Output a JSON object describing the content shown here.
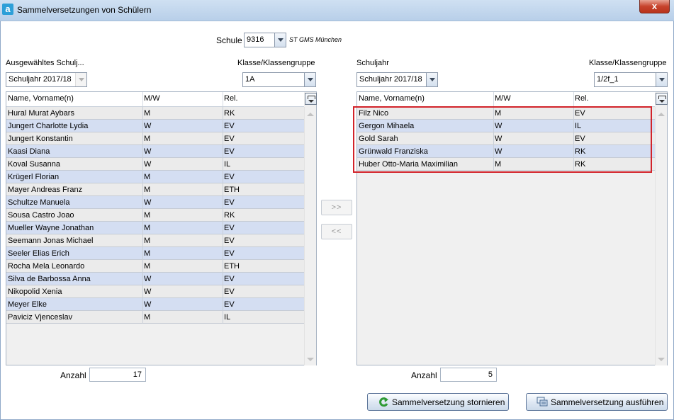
{
  "window": {
    "title": "Sammelversetzungen von Schülern",
    "app_icon_letter": "a",
    "close_symbol": "x"
  },
  "school": {
    "label": "Schule",
    "code": "9316",
    "name": "ST GMS München"
  },
  "left": {
    "year_label": "Ausgewähltes Schulj...",
    "year_value": "Schuljahr 2017/18",
    "class_label": "Klasse/Klassengruppe",
    "class_value": "1A",
    "columns": {
      "name": "Name, Vorname(n)",
      "gender": "M/W",
      "religion": "Rel."
    },
    "rows": [
      {
        "name": "Hural Murat Aybars",
        "gender": "M",
        "religion": "RK"
      },
      {
        "name": "Jungert Charlotte Lydia",
        "gender": "W",
        "religion": "EV"
      },
      {
        "name": "Jungert Konstantin",
        "gender": "M",
        "religion": "EV"
      },
      {
        "name": "Kaasi Diana",
        "gender": "W",
        "religion": "EV"
      },
      {
        "name": "Koval Susanna",
        "gender": "W",
        "religion": "IL"
      },
      {
        "name": "Krügerl Florian",
        "gender": "M",
        "religion": "EV"
      },
      {
        "name": "Mayer Andreas Franz",
        "gender": "M",
        "religion": "ETH"
      },
      {
        "name": "Schultze Manuela",
        "gender": "W",
        "religion": "EV"
      },
      {
        "name": "Sousa Castro Joao",
        "gender": "M",
        "religion": "RK"
      },
      {
        "name": "Mueller Wayne Jonathan",
        "gender": "M",
        "religion": "EV"
      },
      {
        "name": "Seemann Jonas Michael",
        "gender": "M",
        "religion": "EV"
      },
      {
        "name": "Seeler Elias Erich",
        "gender": "M",
        "religion": "EV"
      },
      {
        "name": "Rocha Mela Leonardo",
        "gender": "M",
        "religion": "ETH"
      },
      {
        "name": "Silva de Barbossa Anna",
        "gender": "W",
        "religion": "EV"
      },
      {
        "name": "Nikopolid Xenia",
        "gender": "W",
        "religion": "EV"
      },
      {
        "name": "Meyer Elke",
        "gender": "W",
        "religion": "EV"
      },
      {
        "name": "Paviciz Vjenceslav",
        "gender": "M",
        "religion": "IL"
      }
    ],
    "count_label": "Anzahl",
    "count_value": "17"
  },
  "right": {
    "year_label": "Schuljahr",
    "year_value": "Schuljahr 2017/18",
    "class_label": "Klasse/Klassengruppe",
    "class_value": "1/2f_1",
    "columns": {
      "name": "Name, Vorname(n)",
      "gender": "M/W",
      "religion": "Rel."
    },
    "rows": [
      {
        "name": "Filz Nico",
        "gender": "M",
        "religion": "EV"
      },
      {
        "name": "Gergon Mihaela",
        "gender": "W",
        "religion": "IL"
      },
      {
        "name": "Gold Sarah",
        "gender": "W",
        "religion": "EV"
      },
      {
        "name": "Grünwald Franziska",
        "gender": "W",
        "religion": "RK"
      },
      {
        "name": "Huber Otto-Maria Maximilian",
        "gender": "M",
        "religion": "RK"
      }
    ],
    "count_label": "Anzahl",
    "count_value": "5"
  },
  "transfer": {
    "forward_label": ">>",
    "back_label": "<<"
  },
  "actions": {
    "cancel_label": "Sammelversetzung stornieren",
    "execute_label": "Sammelversetzung ausführen"
  },
  "colors": {
    "row_alt": "#d4def2",
    "row": "#ebebeb",
    "highlight": "#d2232a"
  },
  "icons": {
    "cancel": "undo-arrow-icon",
    "execute": "execute-icon",
    "columns": "column-chooser-icon"
  }
}
